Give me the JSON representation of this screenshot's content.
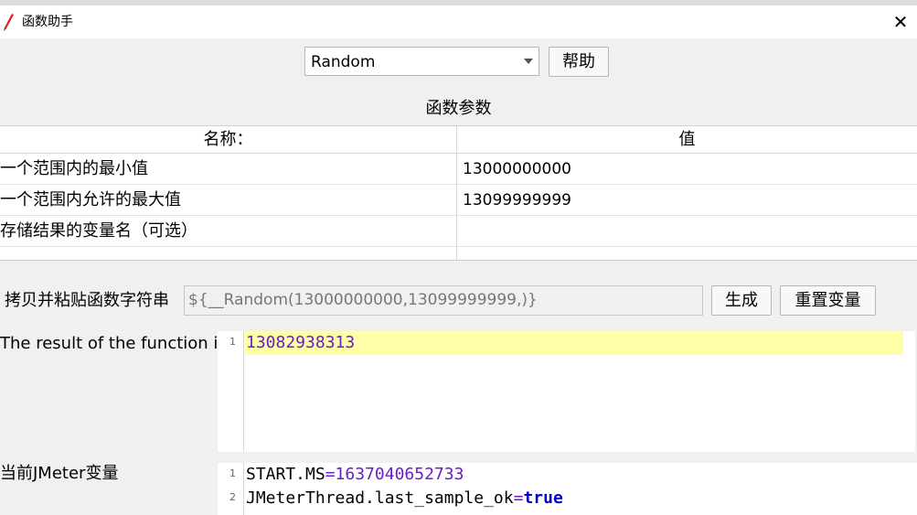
{
  "window": {
    "title": "函数助手",
    "close_glyph": "✕",
    "icon": "feather-icon"
  },
  "function_select": {
    "value": "Random"
  },
  "help_button": "帮助",
  "params": {
    "section_title": "函数参数",
    "headers": {
      "name": "名称：",
      "value": "值"
    },
    "rows": [
      {
        "name": "一个范围内的最小值",
        "value": "13000000000"
      },
      {
        "name": "一个范围内允许的最大值",
        "value": "13099999999"
      },
      {
        "name": "存储结果的变量名（可选）",
        "value": ""
      }
    ]
  },
  "copy": {
    "label": "拷贝并粘贴函数字符串",
    "value": "${__Random(13000000000,13099999999,)}",
    "generate_button": "生成",
    "reset_button": "重置变量"
  },
  "result": {
    "label": "The result of the function is",
    "lines": [
      {
        "num": "1",
        "text": "13082938313"
      }
    ]
  },
  "vars": {
    "label": "当前JMeter变量",
    "lines": [
      {
        "num": "1",
        "key": "START.MS",
        "eq": "=",
        "val": "1637040652733"
      },
      {
        "num": "2",
        "key": "JMeterThread.last_sample_ok",
        "eq": "=",
        "val": "true"
      }
    ]
  },
  "colors": {
    "highlight": "#ffffaa",
    "number": "#6a1fc2",
    "keyword": "#0000c0"
  }
}
